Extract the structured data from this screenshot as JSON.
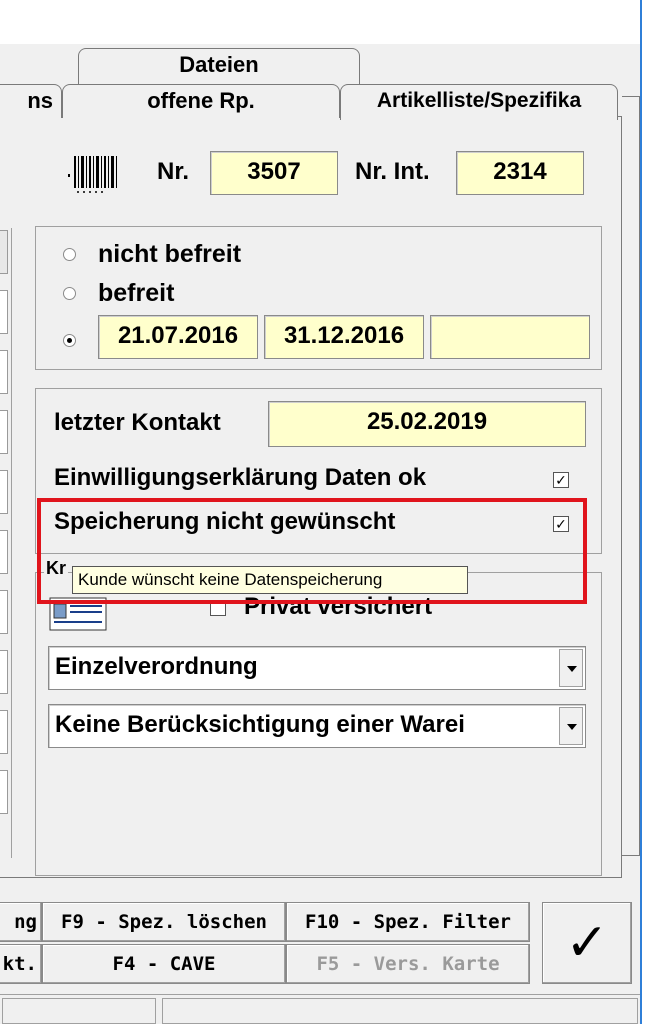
{
  "tabs": {
    "row1": [
      "Dateien"
    ],
    "row2_left_clipped": "ns",
    "row2": [
      "offene Rp.",
      "Artikelliste/Spezifika"
    ]
  },
  "header": {
    "nr_label": "Nr.",
    "nr_value": "3507",
    "nr_int_label": "Nr. Int.",
    "nr_int_value": "2314"
  },
  "exemption": {
    "options": [
      "nicht befreit",
      "befreit"
    ],
    "selected": "date-range",
    "date_from": "21.07.2016",
    "date_to": "31.12.2016",
    "extra": ""
  },
  "contact": {
    "last_contact_label": "letzter Kontakt",
    "last_contact_value": "25.02.2019",
    "consent_label": "Einwilligungserklärung Daten ok",
    "consent_checked": true,
    "no_storage_label": "Speicherung nicht gewünscht",
    "no_storage_checked": true
  },
  "insurance": {
    "group_label_partial": "Kr",
    "private_label": "Privat versichert",
    "prescription_select": "Einzelverordnung",
    "warehouse_select": "Keine Berücksichtigung einer Warei"
  },
  "tooltip": "Kunde wünscht keine Datenspeicherung",
  "function_keys": {
    "row1": [
      "ng",
      "F9 - Spez. löschen",
      "F10 - Spez. Filter"
    ],
    "row2": [
      "kt.",
      "F4 - CAVE",
      "F5 - Vers. Karte"
    ],
    "ok_symbol": "✓"
  },
  "colors": {
    "highlight": "#e0141c",
    "field_bg": "#ffffcc",
    "tooltip_bg": "#ffffe1",
    "accent": "#2f7fd8"
  }
}
